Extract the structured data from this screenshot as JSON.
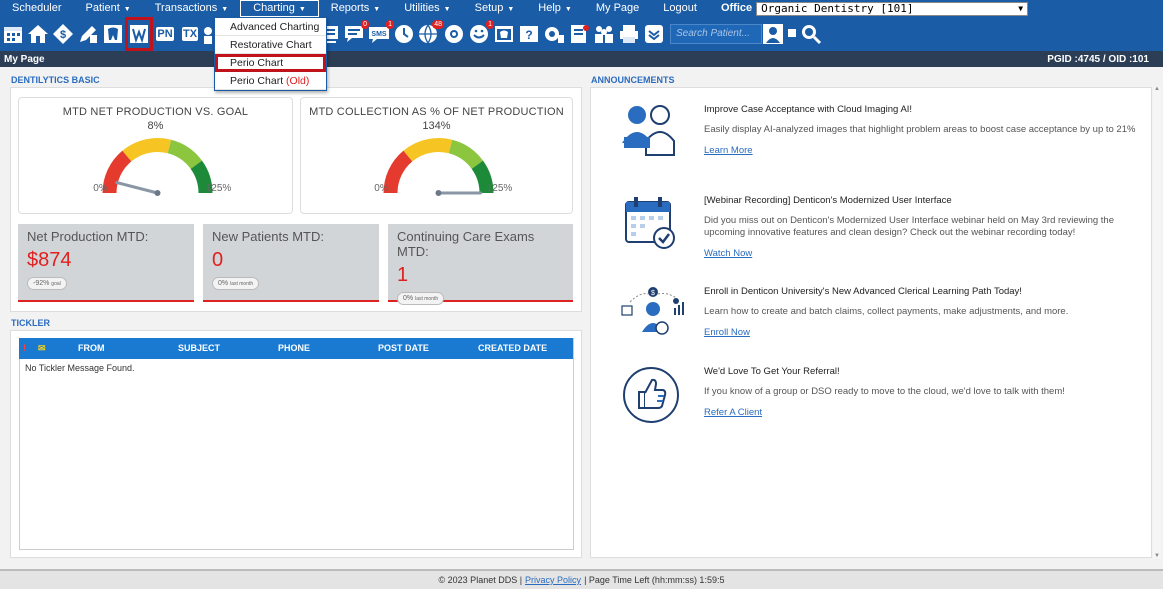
{
  "menu": {
    "items": [
      {
        "label": "Scheduler",
        "caret": false
      },
      {
        "label": "Patient",
        "caret": true
      },
      {
        "label": "Transactions",
        "caret": true
      },
      {
        "label": "Charting",
        "caret": true
      },
      {
        "label": "Reports",
        "caret": true
      },
      {
        "label": "Utilities",
        "caret": true
      },
      {
        "label": "Setup",
        "caret": true
      },
      {
        "label": "Help",
        "caret": true
      },
      {
        "label": "My Page",
        "caret": false
      },
      {
        "label": "Logout",
        "caret": false
      }
    ],
    "office_label": "Office",
    "office_value": "Organic Dentistry [101]"
  },
  "charting_dropdown": {
    "items": [
      "Advanced Charting",
      "Restorative Chart",
      "Perio Chart"
    ],
    "old_item": {
      "label": "Perio Chart",
      "suffix": "(Old)"
    }
  },
  "toolbar": {
    "search_placeholder": "Search Patient...",
    "text_icons": [
      "PN",
      "TX"
    ],
    "badges": {
      "envelope": "0",
      "sms": "1",
      "globe": "48",
      "alert": "1"
    }
  },
  "titlebar": {
    "title": "My Page",
    "ids": "PGID :4745  /  OID :101"
  },
  "dentilytics": {
    "section_title": "DENTILYTICS BASIC",
    "gauges": [
      {
        "title": "MTD NET PRODUCTION VS. GOAL",
        "value": "8%",
        "value_fraction": 0.08,
        "min_label": "0%",
        "max_label": "125%"
      },
      {
        "title": "MTD COLLECTION AS % OF NET PRODUCTION",
        "value": "134%",
        "value_fraction": 1.0,
        "min_label": "0%",
        "max_label": "125%"
      }
    ],
    "stats": [
      {
        "label": "Net Production MTD:",
        "value": "$874",
        "pill_main": "-92%",
        "pill_small": "goal"
      },
      {
        "label": "New Patients MTD:",
        "value": "0",
        "pill_main": "0%",
        "pill_small": "last month"
      },
      {
        "label": "Continuing Care Exams MTD:",
        "value": "1",
        "pill_main": "0%",
        "pill_small": "last month"
      }
    ]
  },
  "tickler": {
    "section_title": "TICKLER",
    "columns": [
      "FROM",
      "SUBJECT",
      "PHONE",
      "POST DATE",
      "CREATED DATE"
    ],
    "empty_message": "No Tickler Message Found."
  },
  "announcements": {
    "section_title": "ANNOUNCEMENTS",
    "items": [
      {
        "title": "Improve Case Acceptance with Cloud Imaging AI!",
        "body": "Easily display AI-analyzed images that highlight problem areas to boost case acceptance by up to 21%",
        "link": "Learn More"
      },
      {
        "title": "[Webinar Recording] Denticon's Modernized User Interface",
        "body": "Did you miss out on Denticon's Modernized User Interface webinar held on May 3rd reviewing the upcoming innovative features and clean design? Check out the webinar recording today!",
        "link": "Watch Now"
      },
      {
        "title": "Enroll in Denticon University's New Advanced Clerical Learning Path Today!",
        "body": "Learn how to create and batch claims, collect payments, make adjustments, and more.",
        "link": "Enroll Now"
      },
      {
        "title": "We'd Love To Get Your Referral!",
        "body": "If you know of a group or DSO ready to move to the cloud, we'd love to talk with them!",
        "link": "Refer A Client"
      }
    ]
  },
  "footer": {
    "copyright": "© 2023 Planet DDS |",
    "privacy": "Privacy Policy",
    "time_left": "| Page Time Left (hh:mm:ss) 1:59:5"
  },
  "colors": {
    "brand": "#1a5ca6",
    "accent": "#2a6cbf",
    "alert": "#e02020",
    "highlight": "#c0121a"
  }
}
